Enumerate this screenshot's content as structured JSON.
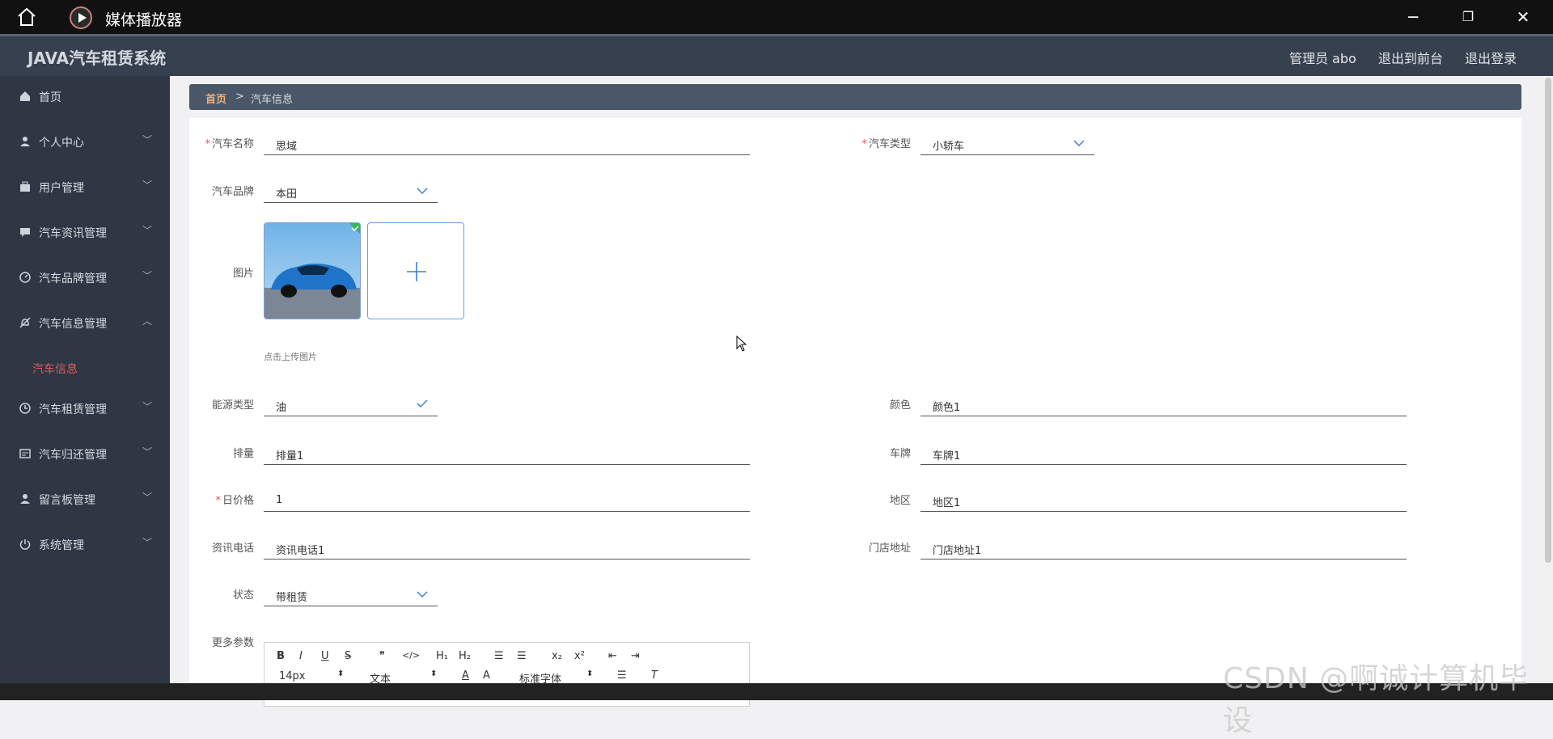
{
  "player": {
    "title": "媒体播放器"
  },
  "header": {
    "brand": "JAVA汽车租赁系统",
    "admin_label": "管理员 abo",
    "exit_front": "退出到前台",
    "logout": "退出登录"
  },
  "sidebar": {
    "items": [
      {
        "label": "首页",
        "icon": "home-icon"
      },
      {
        "label": "个人中心",
        "icon": "user-icon"
      },
      {
        "label": "用户管理",
        "icon": "briefcase-icon"
      },
      {
        "label": "汽车资讯管理",
        "icon": "chat-icon"
      },
      {
        "label": "汽车品牌管理",
        "icon": "gauge-icon"
      },
      {
        "label": "汽车信息管理",
        "icon": "bell-off-icon"
      },
      {
        "label": "汽车租赁管理",
        "icon": "clock-icon"
      },
      {
        "label": "汽车归还管理",
        "icon": "card-icon"
      },
      {
        "label": "留言板管理",
        "icon": "user-icon"
      },
      {
        "label": "系统管理",
        "icon": "power-icon"
      }
    ],
    "active_sub": "汽车信息"
  },
  "breadcrumb": {
    "home": "首页",
    "separator": ">",
    "current": "汽车信息"
  },
  "form": {
    "car_name": {
      "label": "汽车名称",
      "value": "思域"
    },
    "car_type": {
      "label": "汽车类型",
      "value": "小轿车"
    },
    "brand": {
      "label": "汽车品牌",
      "value": "本田"
    },
    "image": {
      "label": "图片",
      "tip": "点击上传图片"
    },
    "energy": {
      "label": "能源类型",
      "value": "油"
    },
    "color": {
      "label": "颜色",
      "value": "颜色1"
    },
    "displacement": {
      "label": "排量",
      "value": "排量1"
    },
    "plate": {
      "label": "车牌",
      "value": "车牌1"
    },
    "daily_price": {
      "label": "日价格",
      "value": "1"
    },
    "region": {
      "label": "地区",
      "value": "地区1"
    },
    "phone": {
      "label": "资讯电话",
      "value": "资讯电话1"
    },
    "store": {
      "label": "门店地址",
      "value": "门店地址1"
    },
    "status": {
      "label": "状态",
      "value": "带租赁"
    },
    "more": {
      "label": "更多参数"
    }
  },
  "editor": {
    "font_size": "14px",
    "text_type": "文本",
    "font_family": "标准字体"
  },
  "watermark": "CSDN @啊诚计算机毕设"
}
